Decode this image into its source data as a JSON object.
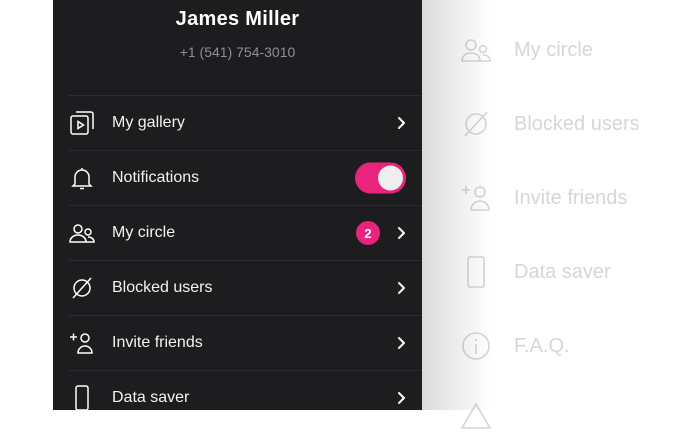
{
  "profile": {
    "name": "James Miller",
    "phone": "+1 (541) 754-3010"
  },
  "menu": [
    {
      "label": "My gallery",
      "icon": "gallery-icon",
      "trailing": "chevron"
    },
    {
      "label": "Notifications",
      "icon": "bell-icon",
      "trailing": "toggle",
      "toggle_on": true
    },
    {
      "label": "My circle",
      "icon": "people-icon",
      "trailing": "chevron",
      "badge": "2"
    },
    {
      "label": "Blocked users",
      "icon": "blocked-icon",
      "trailing": "chevron"
    },
    {
      "label": "Invite friends",
      "icon": "add-person-icon",
      "trailing": "chevron"
    },
    {
      "label": "Data saver",
      "icon": "phone-icon",
      "trailing": "chevron"
    }
  ],
  "background_menu": [
    {
      "label": "My circle",
      "icon": "people-icon"
    },
    {
      "label": "Blocked users",
      "icon": "blocked-icon"
    },
    {
      "label": "Invite friends",
      "icon": "add-person-icon"
    },
    {
      "label": "Data saver",
      "icon": "phone-icon"
    },
    {
      "label": "F.A.Q.",
      "icon": "info-icon"
    }
  ],
  "colors": {
    "drawer_bg": "#1d1d1f",
    "accent": "#e8247c",
    "muted_text": "#8f8f93",
    "faded_background_text": "#d6d6d6"
  }
}
